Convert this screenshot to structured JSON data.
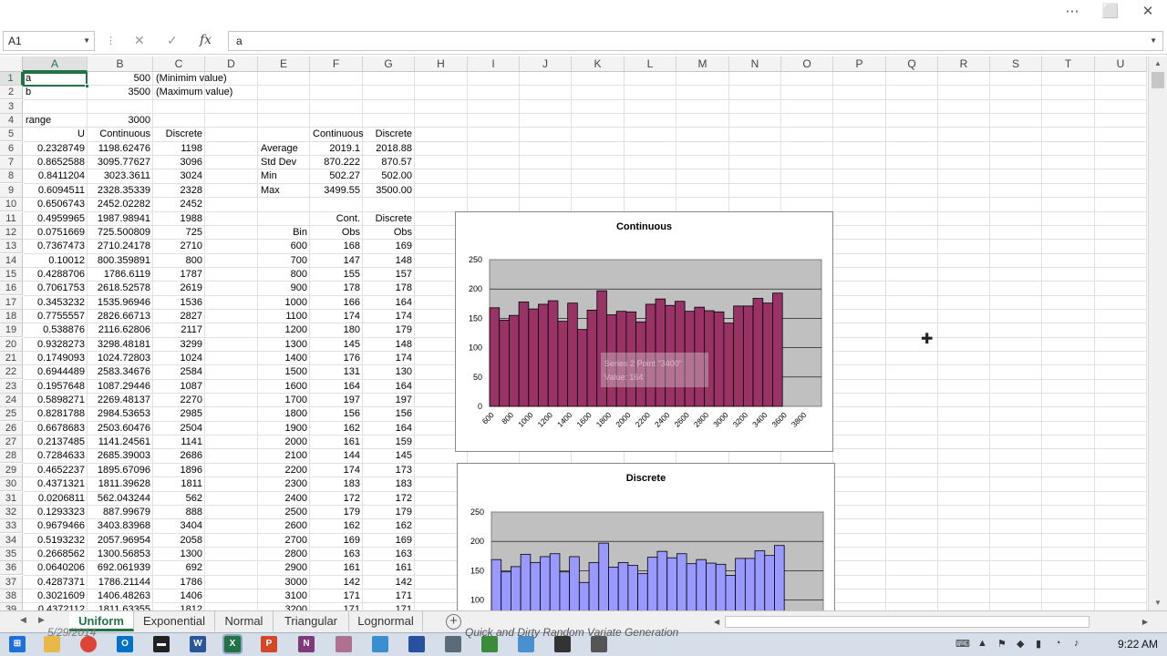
{
  "window": {
    "minimize": "⋯",
    "restore": "⬜",
    "close": "✕"
  },
  "formula_bar": {
    "name_box": "A1",
    "cancel": "✕",
    "enter": "✓",
    "fx": "fx",
    "value": "a"
  },
  "columns": [
    "A",
    "B",
    "C",
    "D",
    "E",
    "F",
    "G",
    "H",
    "I",
    "J",
    "K",
    "L",
    "M",
    "N",
    "O",
    "P",
    "Q",
    "R",
    "S",
    "T",
    "U"
  ],
  "rows": [
    "1",
    "2",
    "3",
    "4",
    "5",
    "6",
    "7",
    "8",
    "9",
    "10",
    "11",
    "12",
    "13",
    "14",
    "15",
    "16",
    "17",
    "18",
    "19",
    "20",
    "21",
    "22",
    "23",
    "24",
    "25",
    "26",
    "27",
    "28",
    "29",
    "30",
    "31",
    "32",
    "33",
    "34",
    "35",
    "36",
    "37",
    "38",
    "39"
  ],
  "params": {
    "a_label": "a",
    "a_value": "500",
    "a_note": "(Minimim value)",
    "b_label": "b",
    "b_value": "3500",
    "b_note": "(Maximum value)",
    "range_label": "range",
    "range_value": "3000"
  },
  "headers": {
    "u": "U",
    "continuous": "Continuous",
    "discrete": "Discrete"
  },
  "samples": [
    [
      "0.2328749",
      "1198.62476",
      "1198"
    ],
    [
      "0.8652588",
      "3095.77627",
      "3096"
    ],
    [
      "0.8411204",
      "3023.3611",
      "3024"
    ],
    [
      "0.6094511",
      "2328.35339",
      "2328"
    ],
    [
      "0.6506743",
      "2452.02282",
      "2452"
    ],
    [
      "0.4959965",
      "1987.98941",
      "1988"
    ],
    [
      "0.0751669",
      "725.500809",
      "725"
    ],
    [
      "0.7367473",
      "2710.24178",
      "2710"
    ],
    [
      "0.10012",
      "800.359891",
      "800"
    ],
    [
      "0.4288706",
      "1786.6119",
      "1787"
    ],
    [
      "0.7061753",
      "2618.52578",
      "2619"
    ],
    [
      "0.3453232",
      "1535.96946",
      "1536"
    ],
    [
      "0.7755557",
      "2826.66713",
      "2827"
    ],
    [
      "0.538876",
      "2116.62806",
      "2117"
    ],
    [
      "0.9328273",
      "3298.48181",
      "3299"
    ],
    [
      "0.1749093",
      "1024.72803",
      "1024"
    ],
    [
      "0.6944489",
      "2583.34676",
      "2584"
    ],
    [
      "0.1957648",
      "1087.29446",
      "1087"
    ],
    [
      "0.5898271",
      "2269.48137",
      "2270"
    ],
    [
      "0.8281788",
      "2984.53653",
      "2985"
    ],
    [
      "0.6678683",
      "2503.60476",
      "2504"
    ],
    [
      "0.2137485",
      "1141.24561",
      "1141"
    ],
    [
      "0.7284633",
      "2685.39003",
      "2686"
    ],
    [
      "0.4652237",
      "1895.67096",
      "1896"
    ],
    [
      "0.4371321",
      "1811.39628",
      "1811"
    ],
    [
      "0.0206811",
      "562.043244",
      "562"
    ],
    [
      "0.1293323",
      "887.99679",
      "888"
    ],
    [
      "0.9679466",
      "3403.83968",
      "3404"
    ],
    [
      "0.5193232",
      "2057.96954",
      "2058"
    ],
    [
      "0.2668562",
      "1300.56853",
      "1300"
    ],
    [
      "0.0640206",
      "692.061939",
      "692"
    ],
    [
      "0.4287371",
      "1786.21144",
      "1786"
    ],
    [
      "0.3021609",
      "1406.48263",
      "1406"
    ],
    [
      "0.4372112",
      "1811.63355",
      "1812"
    ]
  ],
  "stats": {
    "header_cont": "Continuous",
    "header_disc": "Discrete",
    "rows": [
      [
        "Average",
        "2019.1",
        "2018.88"
      ],
      [
        "Std Dev",
        "870.222",
        "870.57"
      ],
      [
        "Min",
        "502.27",
        "502.00"
      ],
      [
        "Max",
        "3499.55",
        "3500.00"
      ]
    ]
  },
  "bins": {
    "h1_cont": "Cont.",
    "h1_disc": "Discrete",
    "h2_bin": "Bin",
    "h2_cont": "Obs",
    "h2_disc": "Obs",
    "rows": [
      [
        "600",
        "168",
        "169"
      ],
      [
        "700",
        "147",
        "148"
      ],
      [
        "800",
        "155",
        "157"
      ],
      [
        "900",
        "178",
        "178"
      ],
      [
        "1000",
        "166",
        "164"
      ],
      [
        "1100",
        "174",
        "174"
      ],
      [
        "1200",
        "180",
        "179"
      ],
      [
        "1300",
        "145",
        "148"
      ],
      [
        "1400",
        "176",
        "174"
      ],
      [
        "1500",
        "131",
        "130"
      ],
      [
        "1600",
        "164",
        "164"
      ],
      [
        "1700",
        "197",
        "197"
      ],
      [
        "1800",
        "156",
        "156"
      ],
      [
        "1900",
        "162",
        "164"
      ],
      [
        "2000",
        "161",
        "159"
      ],
      [
        "2100",
        "144",
        "145"
      ],
      [
        "2200",
        "174",
        "173"
      ],
      [
        "2300",
        "183",
        "183"
      ],
      [
        "2400",
        "172",
        "172"
      ],
      [
        "2500",
        "179",
        "179"
      ],
      [
        "2600",
        "162",
        "162"
      ],
      [
        "2700",
        "169",
        "169"
      ],
      [
        "2800",
        "163",
        "163"
      ],
      [
        "2900",
        "161",
        "161"
      ],
      [
        "3000",
        "142",
        "142"
      ],
      [
        "3100",
        "171",
        "171"
      ],
      [
        "3200",
        "171",
        "171"
      ]
    ]
  },
  "chart_data": [
    {
      "type": "bar",
      "title": "Continuous",
      "color": "#993366",
      "ylim": [
        0,
        250
      ],
      "yticks": [
        "0",
        "50",
        "100",
        "150",
        "200",
        "250"
      ],
      "xticks": [
        "600",
        "800",
        "1000",
        "1200",
        "1400",
        "1600",
        "1800",
        "2000",
        "2200",
        "2400",
        "2600",
        "2800",
        "3000",
        "3200",
        "3400",
        "3600",
        "3800"
      ],
      "values": [
        168,
        147,
        155,
        178,
        166,
        174,
        180,
        145,
        176,
        131,
        164,
        197,
        156,
        162,
        161,
        144,
        174,
        183,
        172,
        179,
        162,
        169,
        163,
        161,
        142,
        171,
        171,
        184,
        176,
        193
      ],
      "slots": 34,
      "tooltip_line1": "Series 2 Point \"3400\"",
      "tooltip_line2": "Value: 164"
    },
    {
      "type": "bar",
      "title": "Discrete",
      "color": "#9999ff",
      "ylim": [
        0,
        250
      ],
      "yticks": [
        "100",
        "150",
        "200",
        "250"
      ],
      "xticks": [],
      "values": [
        169,
        148,
        157,
        178,
        164,
        174,
        179,
        148,
        174,
        130,
        164,
        197,
        156,
        164,
        159,
        145,
        173,
        183,
        172,
        179,
        162,
        169,
        163,
        161,
        142,
        171,
        171,
        184,
        176,
        193
      ],
      "slots": 34
    }
  ],
  "tabs": [
    "Uniform",
    "Exponential",
    "Normal",
    "Triangular",
    "Lognormal"
  ],
  "add_sheet": "+",
  "taskbar": {
    "time": "9:22 AM",
    "caption": "Quick and Dirty Random Variate Generation",
    "date": "5/29/2014"
  }
}
